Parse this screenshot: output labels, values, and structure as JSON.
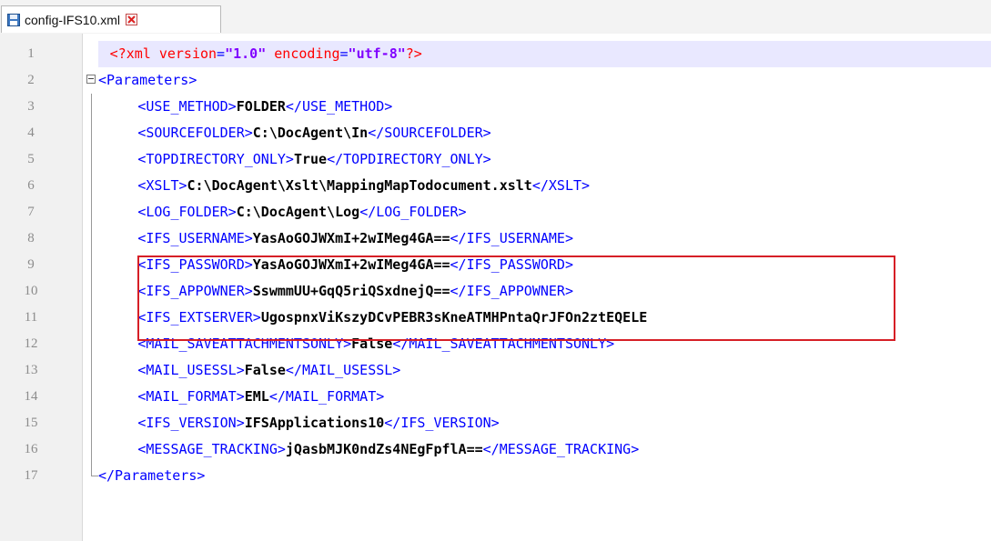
{
  "tab": {
    "filename": "config-IFS10.xml"
  },
  "editor": {
    "lines": [
      {
        "n": "1",
        "text": "<?xml version=\"1.0\" encoding=\"utf-8\"?>"
      },
      {
        "n": "2",
        "text": "<Parameters>"
      },
      {
        "n": "3",
        "text": "<USE_METHOD>FOLDER</USE_METHOD>"
      },
      {
        "n": "4",
        "text": "<SOURCEFOLDER>C:\\DocAgent\\In</SOURCEFOLDER>"
      },
      {
        "n": "5",
        "text": "<TOPDIRECTORY_ONLY>True</TOPDIRECTORY_ONLY>"
      },
      {
        "n": "6",
        "text": "<XSLT>C:\\DocAgent\\Xslt\\MappingMapTodocument.xslt</XSLT>"
      },
      {
        "n": "7",
        "text": "<LOG_FOLDER>C:\\DocAgent\\Log</LOG_FOLDER>"
      },
      {
        "n": "8",
        "text": "<IFS_USERNAME>YasAoGOJWXmI+2wIMeg4GA==</IFS_USERNAME>"
      },
      {
        "n": "9",
        "text": "<IFS_PASSWORD>YasAoGOJWXmI+2wIMeg4GA==</IFS_PASSWORD>"
      },
      {
        "n": "10",
        "text": "<IFS_APPOWNER>SswmmUU+GqQ5riQSxdnejQ==</IFS_APPOWNER>"
      },
      {
        "n": "11",
        "text": "<IFS_EXTSERVER>UgospnxViKszyDCvPEBR3sKneATMHPntaQrJFOn2ztEQELE"
      },
      {
        "n": "12",
        "text": "<MAIL_SAVEATTACHMENTSONLY>False</MAIL_SAVEATTACHMENTSONLY>"
      },
      {
        "n": "13",
        "text": "<MAIL_USESSL>False</MAIL_USESSL>"
      },
      {
        "n": "14",
        "text": "<MAIL_FORMAT>EML</MAIL_FORMAT>"
      },
      {
        "n": "15",
        "text": "<IFS_VERSION>IFSApplications10</IFS_VERSION>"
      },
      {
        "n": "16",
        "text": "<MESSAGE_TRACKING>jQasbMJK0ndZs4NEgFpflA==</MESSAGE_TRACKING>"
      },
      {
        "n": "17",
        "text": "</Parameters>"
      }
    ]
  },
  "colors": {
    "tag": "#0000ff",
    "processing_instruction": "#ff0000",
    "attribute_value": "#8000ff",
    "text_value": "#000000",
    "highlight_box": "#d61f26",
    "current_line": "#e9e8ff"
  },
  "icons": {
    "tab_icon": "save-icon",
    "tab_close": "close-icon",
    "fold_marker": "fold-collapse-icon"
  }
}
